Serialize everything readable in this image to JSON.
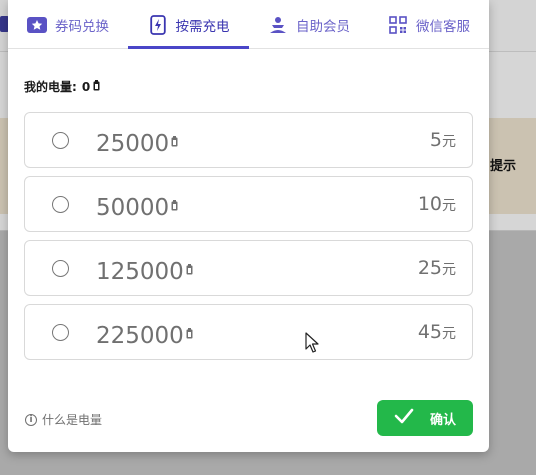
{
  "background": {
    "side_text": "提示"
  },
  "tabs": [
    {
      "label": "券码兑换",
      "icon": "star-ticket-icon"
    },
    {
      "label": "按需充电",
      "icon": "charge-phone-icon"
    },
    {
      "label": "自助会员",
      "icon": "person-icon"
    },
    {
      "label": "微信客服",
      "icon": "qr-code-icon"
    }
  ],
  "active_tab": 1,
  "balance": {
    "label": "我的电量:",
    "value": "0"
  },
  "options": [
    {
      "amount": "25000",
      "price": "5",
      "unit": "元"
    },
    {
      "amount": "50000",
      "price": "10",
      "unit": "元"
    },
    {
      "amount": "125000",
      "price": "25",
      "unit": "元"
    },
    {
      "amount": "225000",
      "price": "45",
      "unit": "元"
    }
  ],
  "footer": {
    "help_text": "什么是电量",
    "confirm_label": "确认"
  },
  "colors": {
    "accent": "#4a46c8",
    "tab_text": "#6b63c9",
    "confirm": "#23b84a"
  }
}
